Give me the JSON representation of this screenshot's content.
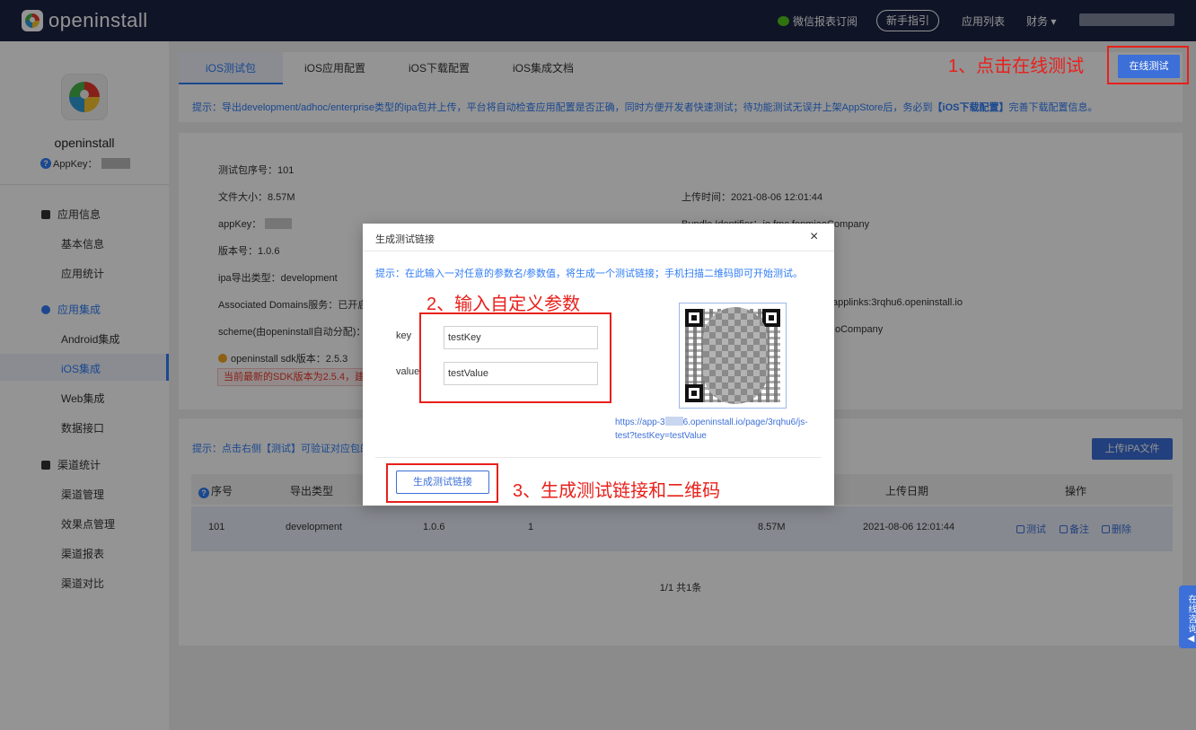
{
  "topbar": {
    "brand": "openinstall",
    "wechat": "微信报表订阅",
    "guide": "新手指引",
    "apps": "应用列表",
    "finance": "财务 ▾"
  },
  "sidebar": {
    "app_name": "openinstall",
    "appkey_label": "AppKey：",
    "groups": [
      {
        "label": "应用信息",
        "items": [
          "基本信息",
          "应用统计"
        ]
      },
      {
        "label": "应用集成",
        "items": [
          "Android集成",
          "iOS集成",
          "Web集成",
          "数据接口"
        ]
      },
      {
        "label": "渠道统计",
        "items": [
          "渠道管理",
          "效果点管理",
          "渠道报表",
          "渠道对比"
        ]
      }
    ]
  },
  "tabs": [
    "iOS测试包",
    "iOS应用配置",
    "iOS下载配置",
    "iOS集成文档"
  ],
  "tip": {
    "prefix": "提示：导出development/adhoc/enterprise类型的ipa包并上传，平台将自动检查应用配置是否正确，同时方便开发者快速测试；待功能测试无误并上架AppStore后，务必到",
    "link": "【iOS下载配置】",
    "suffix": "完善下载配置信息。"
  },
  "online_test_button": "在线测试",
  "annotations": {
    "step1": "1、点击在线测试",
    "step2": "2、输入自定义参数",
    "step3": "3、生成测试链接和二维码"
  },
  "info": {
    "pkg_no": "测试包序号：101",
    "file_size": "文件大小：8.57M",
    "upload_time": "上传时间：2021-08-06 12:01:44",
    "appkey": "appKey：",
    "bundle": "Bundle Identifier：io.fmc.fenmiaoCompany",
    "version": "版本号：1.0.6",
    "ipa_type": "ipa导出类型：development",
    "assoc": "Associated Domains服务：已开启",
    "applinks": "applinks:3rqhu6.openinstall.io",
    "scheme": "scheme(由openinstall自动分配)：F",
    "scheme_right": "oCompany",
    "sdk": "openinstall sdk版本：2.5.3",
    "sdk_warning": "当前最新的SDK版本为2.5.4，建议"
  },
  "list": {
    "tip": "提示：点击右侧【测试】可验证对应包的",
    "upload_button": "上传IPA文件",
    "headers": {
      "no": "序号",
      "type": "导出类型",
      "date": "上传日期",
      "ops": "操作"
    },
    "row": {
      "no": "101",
      "type": "development",
      "version": "1.0.6",
      "count": "1",
      "size": "8.57M",
      "date": "2021-08-06 12:01:44"
    },
    "ops": {
      "test": "测试",
      "note": "备注",
      "delete": "删除"
    },
    "pager": "1/1 共1条"
  },
  "modal": {
    "title": "生成测试链接",
    "close": "×",
    "tip": "提示：在此输入一对任意的参数名/参数值，将生成一个测试链接；手机扫描二维码即可开始测试。",
    "key_label": "key",
    "value_label": "value",
    "key_value": "testKey",
    "value_value": "testValue",
    "link_prefix": "https://app-3",
    "link_suffix": "6.openinstall.io/page/3rqhu6/js-test?testKey=testValue",
    "generate_button": "生成测试链接"
  },
  "consult": "在线咨询◀"
}
